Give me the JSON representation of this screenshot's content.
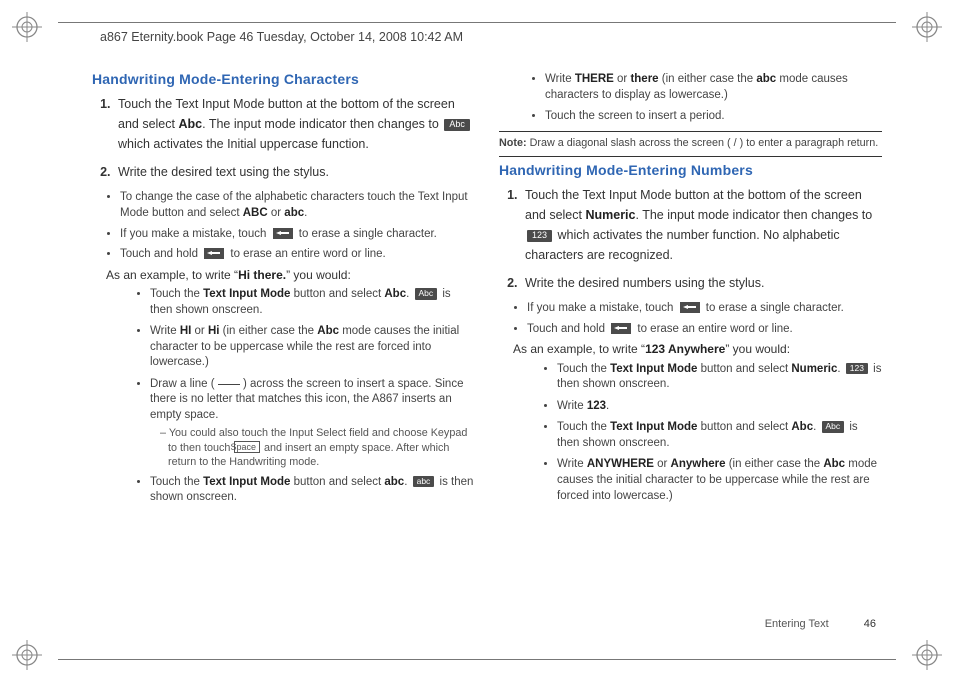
{
  "header": {
    "running_head": "a867 Eternity.book  Page 46  Tuesday, October 14, 2008  10:42 AM"
  },
  "left": {
    "h": "Handwriting Mode-Entering Characters",
    "step1_a": "Touch the Text Input Mode button at the bottom of the screen and select ",
    "step1_b": "Abc",
    "step1_c": ". The input mode indicator then changes to ",
    "step1_d": " which activates the Initial uppercase function.",
    "abc_chip": "Abc",
    "step2": "Write the desired text using the stylus.",
    "b1_a": "To change the case of the alphabetic characters touch the Text Input Mode button and select ",
    "b1_b": "ABC",
    "b1_c": " or ",
    "b1_d": "abc",
    "b1_e": ".",
    "b2_a": "If you make a mistake, touch ",
    "b2_b": " to erase a single character.",
    "b3_a": "Touch and hold ",
    "b3_b": " to erase an entire word or line.",
    "ex_a": "As an example, to write “",
    "ex_b": "Hi there.",
    "ex_c": "” you would:",
    "e1_a": "Touch the ",
    "e1_b": "Text Input Mode",
    "e1_c": " button and select ",
    "e1_d": "Abc",
    "e1_e": ". ",
    "e1_f": " is then shown onscreen.",
    "e2_a": "Write ",
    "e2_b": "HI",
    "e2_c": " or ",
    "e2_d": "Hi",
    "e2_e": " (in either case the ",
    "e2_f": "Abc",
    "e2_g": " mode causes the initial character to be uppercase while the rest are forced into lowercase.)",
    "e3_a": "Draw a line ( ",
    "e3_b": " ) across the screen to insert a space. Since there is no letter that matches this icon, the A867 inserts an empty space.",
    "e3s_a": "You could also touch the Input Select field and choose Keypad to then touch ",
    "e3s_space": "Space",
    "e3s_b": " and insert an empty space. After which return to the Handwriting mode.",
    "e4_a": "Touch the ",
    "e4_b": "Text Input Mode",
    "e4_c": " button and select ",
    "e4_d": "abc",
    "e4_e": ". ",
    "abc_lc_chip": "abc",
    "e4_f": " is then shown onscreen."
  },
  "right": {
    "c1_a": "Write ",
    "c1_b": "THERE",
    "c1_c": " or ",
    "c1_d": "there",
    "c1_e": " (in either case the ",
    "c1_f": "abc",
    "c1_g": " mode causes characters to display as lowercase.)",
    "c2": "Touch the screen to insert a period.",
    "note_lbl": "Note:",
    "note_txt": " Draw a diagonal slash across the screen ( / ) to enter a paragraph return.",
    "h": "Handwriting Mode-Entering Numbers",
    "s1_a": "Touch the Text Input Mode button at the bottom of the screen and select ",
    "s1_b": "Numeric",
    "s1_c": ". The input mode indicator then changes to ",
    "num_chip": "123",
    "s1_d": " which activates the number function. No alphabetic characters are recognized.",
    "s2": "Write the desired numbers using the stylus.",
    "b1_a": "If you make a mistake, touch ",
    "b1_b": " to erase a single character.",
    "b2_a": "Touch and hold ",
    "b2_b": " to erase an entire word or line.",
    "ex_a": "As an example, to write “",
    "ex_b": "123 Anywhere",
    "ex_c": "” you would:",
    "r1_a": "Touch the ",
    "r1_b": "Text Input Mode",
    "r1_c": " button and select ",
    "r1_d": "Numeric",
    "r1_e": ". ",
    "r1_f": " is then shown onscreen.",
    "r2_a": "Write ",
    "r2_b": "123",
    "r2_c": ".",
    "r3_a": "Touch the ",
    "r3_b": "Text Input Mode",
    "r3_c": " button and select ",
    "r3_d": "Abc",
    "r3_e": ". ",
    "abc_chip": "Abc",
    "r3_f": " is then shown onscreen.",
    "r4_a": "Write ",
    "r4_b": "ANYWHERE",
    "r4_c": " or ",
    "r4_d": "Anywhere",
    "r4_e": " (in either case the ",
    "r4_f": "Abc",
    "r4_g": " mode causes the initial character to be uppercase while the rest are forced into lowercase.)"
  },
  "footer": {
    "section": "Entering Text",
    "page": "46"
  }
}
